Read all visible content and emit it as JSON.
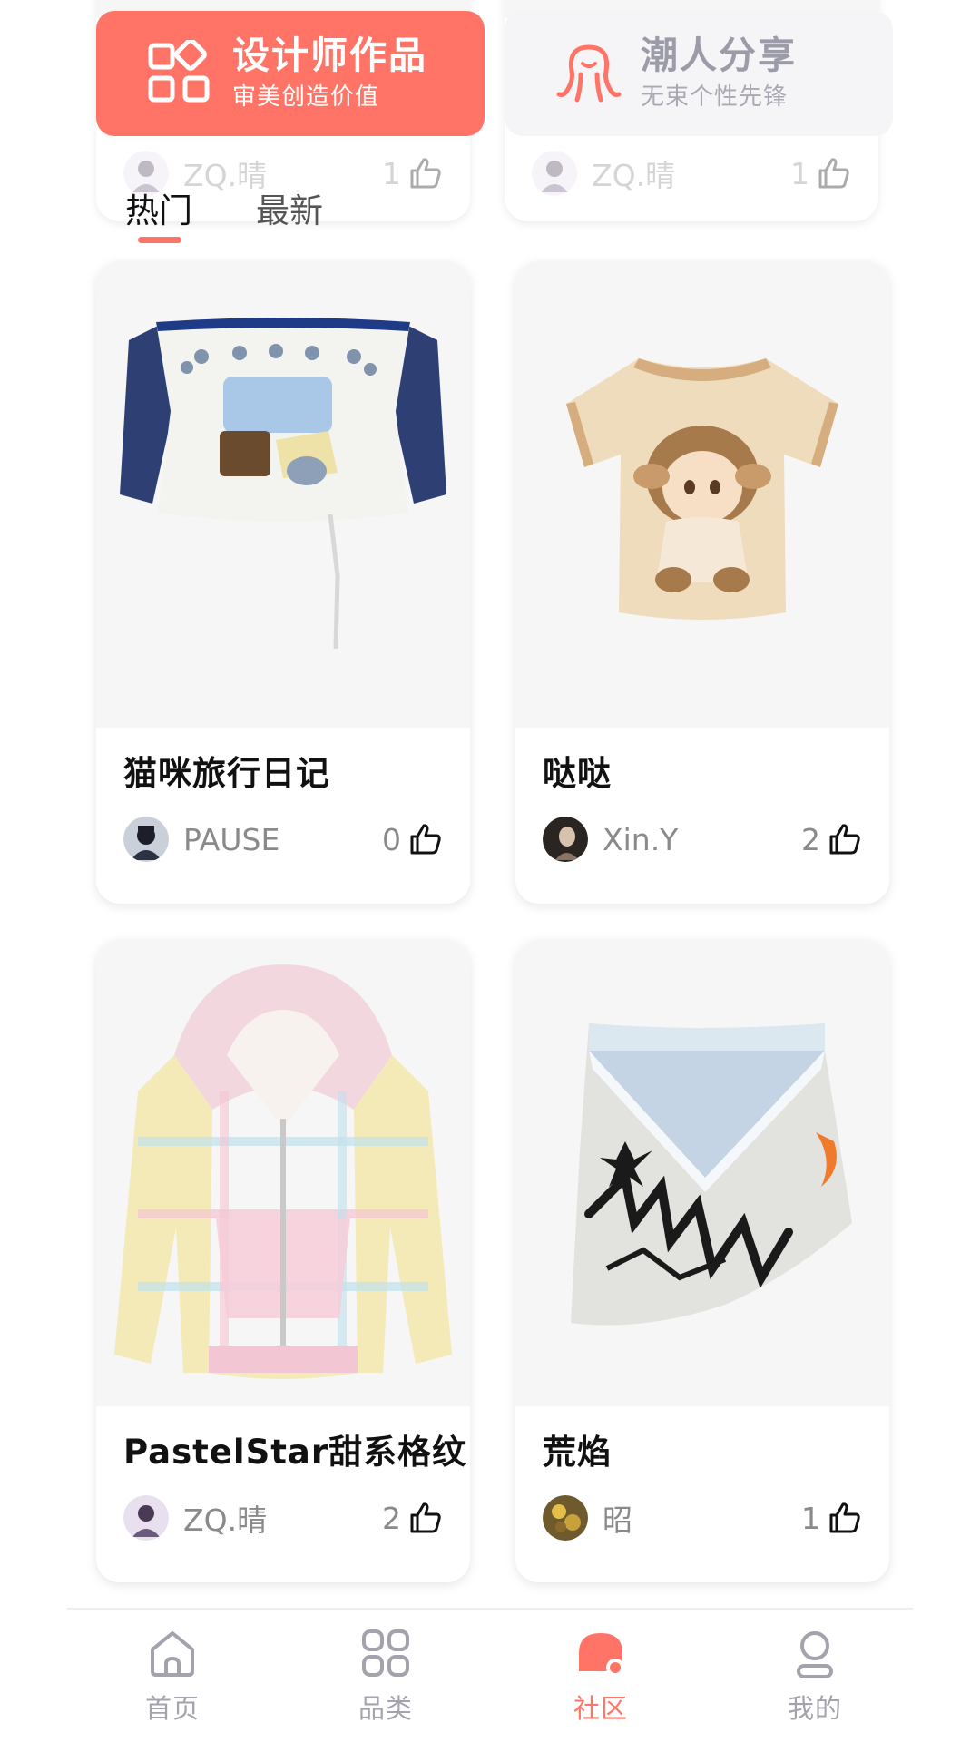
{
  "colors": {
    "accent": "#ff7466",
    "banner_inactive_bg": "#f5f5f7",
    "card_image_bg": "#f6f6f6",
    "nav_inactive": "#a3a3ad"
  },
  "peek_cards": [
    {
      "author": "ZQ.晴",
      "likes": "1"
    },
    {
      "author": "ZQ.晴",
      "likes": "1"
    }
  ],
  "banners": {
    "designer": {
      "title": "设计师作品",
      "subtitle": "审美创造价值",
      "icon": "grid-diamond-icon"
    },
    "trend": {
      "title": "潮人分享",
      "subtitle": "无束个性先锋",
      "icon": "octopus-icon"
    }
  },
  "tabs": [
    {
      "label": "热门",
      "active": true
    },
    {
      "label": "最新",
      "active": false
    }
  ],
  "cards": [
    {
      "title": "猫咪旅行日记",
      "author": "PAUSE",
      "likes": "0",
      "image": "off-shoulder-top-cat-print"
    },
    {
      "title": "哒哒",
      "author": "Xin.Y",
      "likes": "2",
      "image": "beige-tshirt-chibi-boy"
    },
    {
      "title": "PastelStar甜系格纹",
      "author": "ZQ.晴",
      "likes": "2",
      "image": "pastel-plaid-hooded-jacket"
    },
    {
      "title": "荒焰",
      "author": "昭",
      "likes": "1",
      "image": "graffiti-denim-skirt"
    }
  ],
  "bottom_nav": [
    {
      "label": "首页",
      "icon": "home-icon",
      "active": false
    },
    {
      "label": "品类",
      "icon": "category-grid-icon",
      "active": false
    },
    {
      "label": "社区",
      "icon": "community-icon",
      "active": true
    },
    {
      "label": "我的",
      "icon": "profile-icon",
      "active": false
    }
  ]
}
